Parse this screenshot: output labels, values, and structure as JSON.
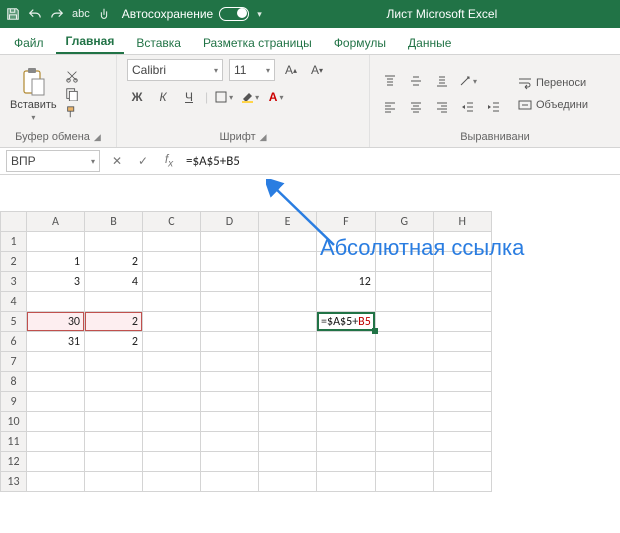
{
  "titlebar": {
    "autosave_label": "Автосохранение",
    "doc_title": "Лист Microsoft Excel"
  },
  "tabs": {
    "file": "Файл",
    "home": "Главная",
    "insert": "Вставка",
    "layout": "Разметка страницы",
    "formulas": "Формулы",
    "data": "Данные"
  },
  "ribbon": {
    "clipboard": {
      "paste": "Вставить",
      "group": "Буфер обмена"
    },
    "font": {
      "name": "Calibri",
      "size": "11",
      "bold": "Ж",
      "italic": "К",
      "underline": "Ч",
      "group": "Шрифт"
    },
    "align": {
      "wrap": "Переноси",
      "merge": "Объедини",
      "group": "Выравнивани"
    }
  },
  "formula_bar": {
    "namebox": "ВПР",
    "formula": "=$A$5+B5"
  },
  "columns": [
    "A",
    "B",
    "C",
    "D",
    "E",
    "F",
    "G",
    "H"
  ],
  "rows": [
    "1",
    "2",
    "3",
    "4",
    "5",
    "6",
    "7",
    "8",
    "9",
    "10",
    "11",
    "12",
    "13"
  ],
  "cells": {
    "A2": "1",
    "B2": "2",
    "A3": "3",
    "B3": "4",
    "F3": "12",
    "A5": "30",
    "B5": "2",
    "A6": "31",
    "B6": "2"
  },
  "active_formula": {
    "prefix": "=",
    "abs": "$A$5",
    "plus": "+",
    "rel": "B5"
  },
  "annotation": "Абсолютная ссылка"
}
